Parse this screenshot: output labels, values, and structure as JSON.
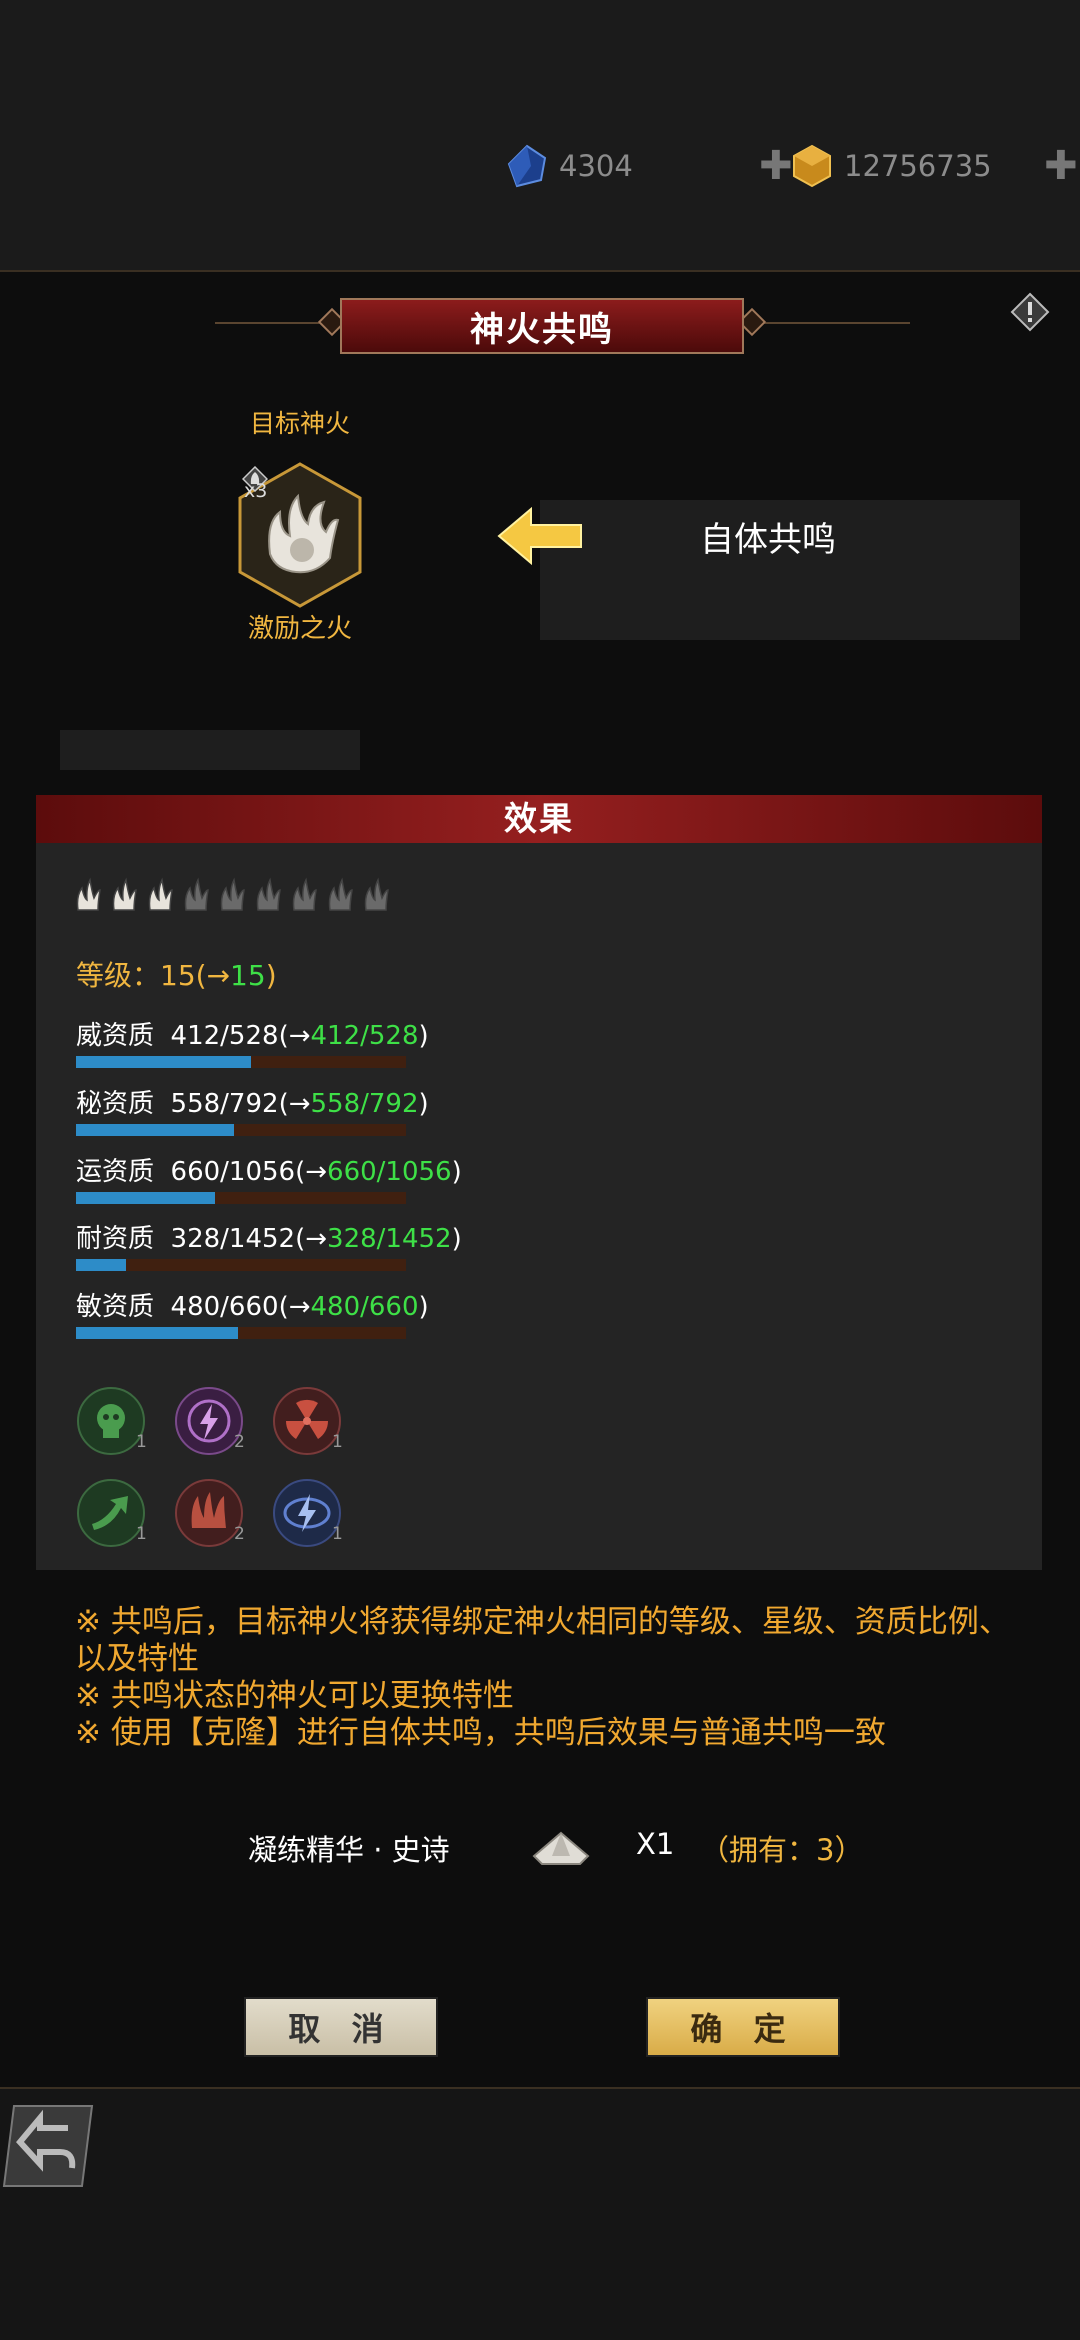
{
  "currency": {
    "gem": {
      "value": "4304",
      "icon": "blue-crystal-icon"
    },
    "gold": {
      "value": "12756735",
      "icon": "gold-cube-icon"
    }
  },
  "modal": {
    "title": "神火共鸣",
    "target_label": "目标神火",
    "target_count": "x3",
    "target_name": "激励之火",
    "mode_label": "自体共鸣"
  },
  "effect": {
    "header": "效果",
    "stars_total": 9,
    "stars_lit": 3,
    "level": {
      "label": "等级：",
      "current": "15",
      "arrow": "(→",
      "new": "15",
      "close": ")"
    },
    "stats": [
      {
        "label": "威资质",
        "current": "412/528",
        "arrow": "(→",
        "new": "412/528",
        "close": ")",
        "fill": 0.53
      },
      {
        "label": "秘资质",
        "current": "558/792",
        "arrow": "(→",
        "new": "558/792",
        "close": ")",
        "fill": 0.48
      },
      {
        "label": "运资质",
        "current": "660/1056",
        "arrow": "(→",
        "new": "660/1056",
        "close": ")",
        "fill": 0.42
      },
      {
        "label": "耐资质",
        "current": "328/1452",
        "arrow": "(→",
        "new": "328/1452",
        "close": ")",
        "fill": 0.15
      },
      {
        "label": "敏资质",
        "current": "480/660",
        "arrow": "(→",
        "new": "480/660",
        "close": ")",
        "fill": 0.49
      }
    ],
    "traits": [
      {
        "icon": "green-skull-icon",
        "count": "1"
      },
      {
        "icon": "purple-lightning-icon",
        "count": "2"
      },
      {
        "icon": "red-radiation-icon",
        "count": "1"
      },
      {
        "icon": "green-arrow-icon",
        "count": "1"
      },
      {
        "icon": "red-claw-icon",
        "count": "2"
      },
      {
        "icon": "blue-lightning-icon",
        "count": "1"
      }
    ]
  },
  "notes": [
    "※ 共鸣后，目标神火将获得绑定神火相同的等级、星级、资质比例、以及特性",
    "※ 共鸣状态的神火可以更换特性",
    "※ 使用【克隆】进行自体共鸣，共鸣后效果与普通共鸣一致"
  ],
  "cost": {
    "item_name": "凝练精华 · 史诗",
    "quantity": "X1",
    "owned": "（拥有：3）"
  },
  "buttons": {
    "cancel": "取 消",
    "confirm": "确 定"
  },
  "colors": {
    "accent_gold": "#f0b640",
    "accent_green": "#3ee047",
    "header_red": "#951f1f",
    "bar_blue": "#2d8cc8"
  }
}
